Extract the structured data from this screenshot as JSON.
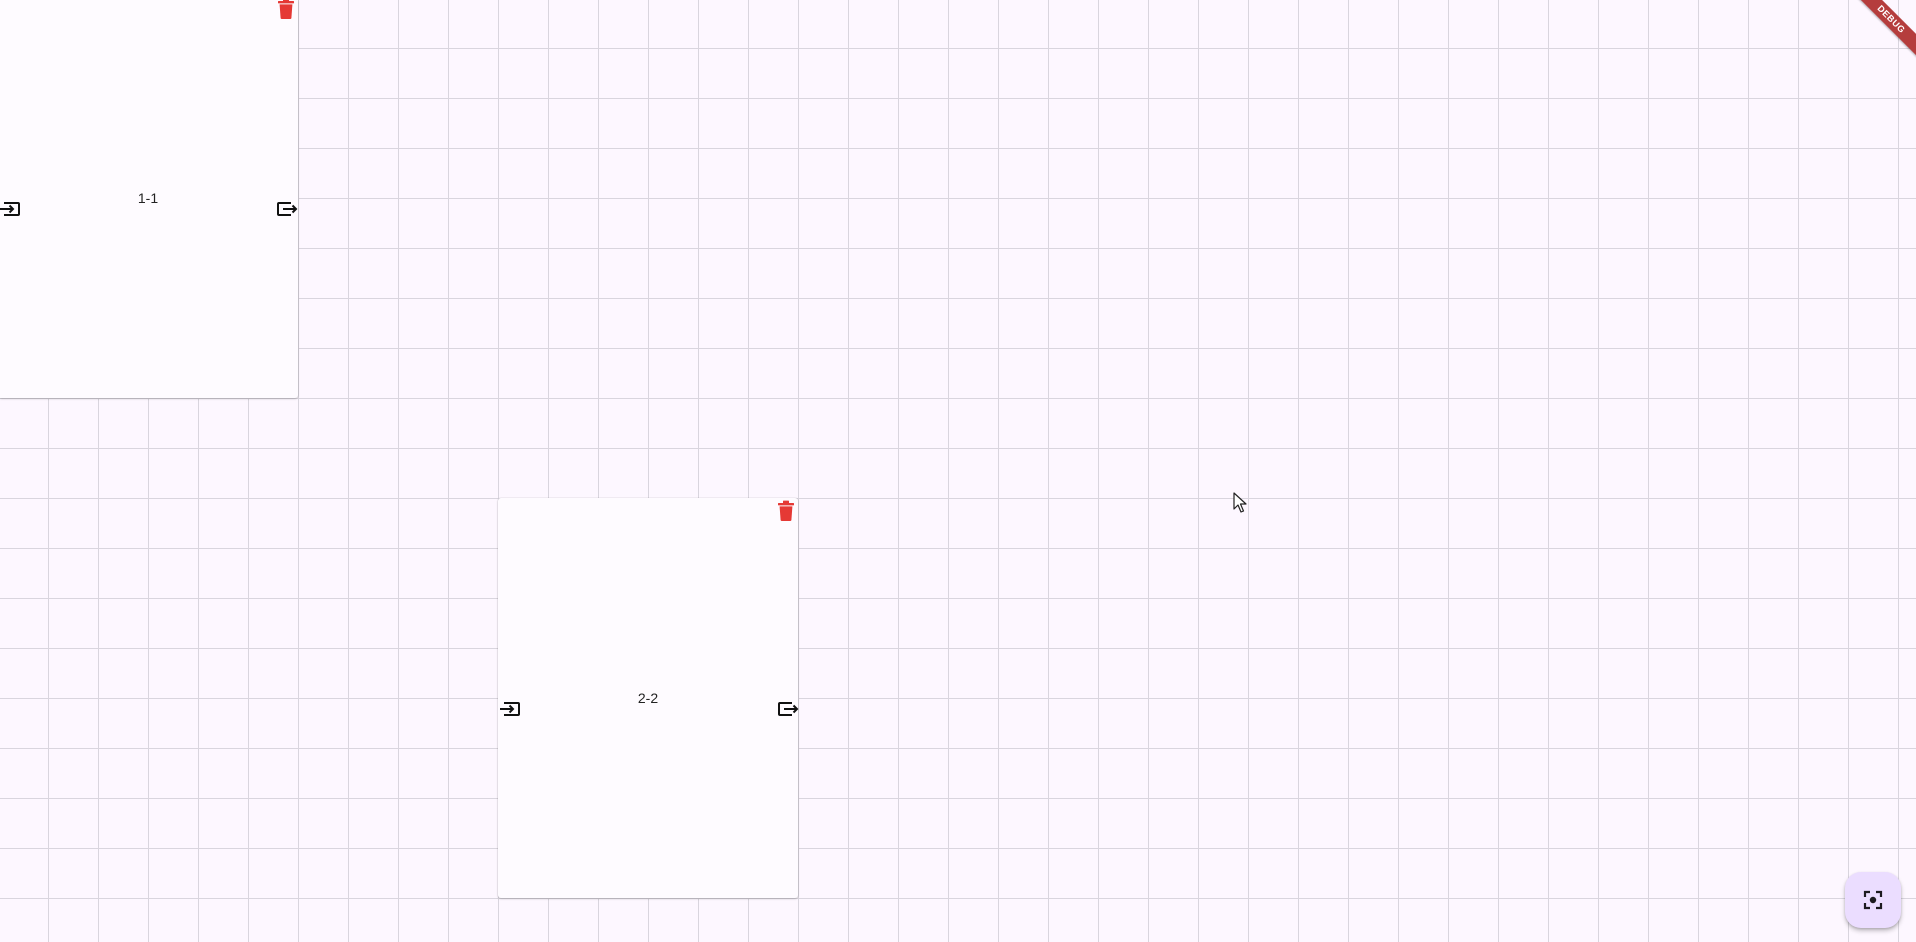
{
  "canvas": {
    "background": "#fdf7ff",
    "grid_color": "#d9d5de"
  },
  "nodes": [
    {
      "label": "1-1",
      "delete_icon": "trash-icon",
      "input_icon": "port-input-icon",
      "output_icon": "port-output-icon"
    },
    {
      "label": "2-2",
      "delete_icon": "trash-icon",
      "input_icon": "port-input-icon",
      "output_icon": "port-output-icon"
    }
  ],
  "debug_banner": {
    "label": "DEBUG",
    "color": "#b53d3d"
  },
  "fit_button": {
    "icon": "fit-screen-icon",
    "background": "#ebddff"
  },
  "colors": {
    "delete": "#e53935",
    "icon": "#111111",
    "node_background": "#fefbff"
  }
}
